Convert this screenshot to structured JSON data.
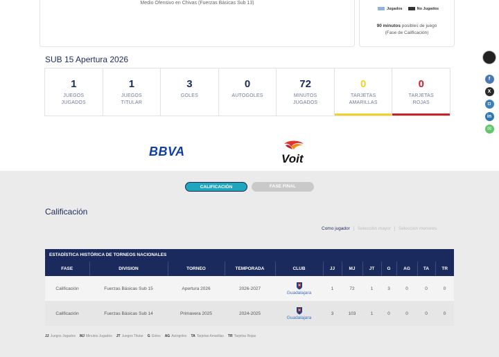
{
  "top_card": {
    "position_text": "Medio Ofensivo en Chivas (Fuerzas Básicas Sub 13)"
  },
  "minutes_card": {
    "legend_played": "Jugados",
    "legend_not_played": "No Jugados",
    "minutes_bold": "90 minutos",
    "minutes_rest": " posibles de juego",
    "phase_note": "(Fase de Calificación)",
    "colors": {
      "played": "#8db4dc",
      "not_played": "#333333"
    }
  },
  "season": {
    "title": "SUB 15 Apertura 2026",
    "stats": [
      {
        "value": "1",
        "label_line1": "JUEGOS",
        "label_line2": "JUGADOS"
      },
      {
        "value": "1",
        "label_line1": "JUEGOS",
        "label_line2": "TITULAR"
      },
      {
        "value": "3",
        "label_line1": "GOLES",
        "label_line2": ""
      },
      {
        "value": "0",
        "label_line1": "AUTOGOLES",
        "label_line2": ""
      },
      {
        "value": "72",
        "label_line1": "MINUTOS",
        "label_line2": "JUGADOS"
      },
      {
        "value": "0",
        "label_line1": "TARJETAS",
        "label_line2": "AMARILLAS"
      },
      {
        "value": "0",
        "label_line1": "TARJETAS",
        "label_line2": "ROJAS"
      }
    ],
    "colors": {
      "yellow": "#f1d22a",
      "red": "#c8232c"
    }
  },
  "sponsors": {
    "bbva": "BBVA",
    "voit": "Voit"
  },
  "tabs": {
    "calificacion": "CALIFICACIÓN",
    "fase_final": "FASE FINAL"
  },
  "calificacion": {
    "title": "Calificación",
    "selection_links": [
      "Como jugador",
      "Selección mayor",
      "Selección menores"
    ]
  },
  "table": {
    "title": "ESTADÍSTICA HISTÓRICA DE TORNEOS NACIONALES",
    "headers": [
      "FASE",
      "DIVISION",
      "TORNEO",
      "TEMPORADA",
      "CLUB",
      "JJ",
      "MJ",
      "JT",
      "G",
      "AG",
      "TA",
      "TR"
    ],
    "rows": [
      {
        "fase": "Calificación",
        "division": "Fuerzas Básicas Sub 15",
        "torneo": "Apertura 2026",
        "temporada": "2026-2027",
        "club": "Guadalajara",
        "jj": "1",
        "mj": "72",
        "jt": "1",
        "g": "3",
        "ag": "0",
        "ta": "0",
        "tr": "0"
      },
      {
        "fase": "Calificación",
        "division": "Fuerzas Básicas Sub 14",
        "torneo": "Primavera 2025",
        "temporada": "2024-2025",
        "club": "Guadalajara",
        "jj": "3",
        "mj": "103",
        "jt": "1",
        "g": "0",
        "ag": "0",
        "ta": "0",
        "tr": "0"
      }
    ]
  },
  "abbreviations": [
    {
      "abbr": "JJ",
      "desc": "Juegos Jugados"
    },
    {
      "abbr": "MJ",
      "desc": "Minutos Jugados"
    },
    {
      "abbr": "JT",
      "desc": "Juegos Titular"
    },
    {
      "abbr": "G",
      "desc": "Goles"
    },
    {
      "abbr": "AG",
      "desc": "Autogoles"
    },
    {
      "abbr": "TA",
      "desc": "Tarjetas Amarillas"
    },
    {
      "abbr": "TR",
      "desc": "Tarjetas Rojas"
    }
  ],
  "social": {
    "icons": [
      "facebook-icon",
      "x-icon",
      "instagram-icon",
      "linkedin-icon",
      "email-icon"
    ],
    "facebook": "f",
    "x": "X",
    "instagram": "◘",
    "linkedin": "in",
    "email": "✉"
  }
}
